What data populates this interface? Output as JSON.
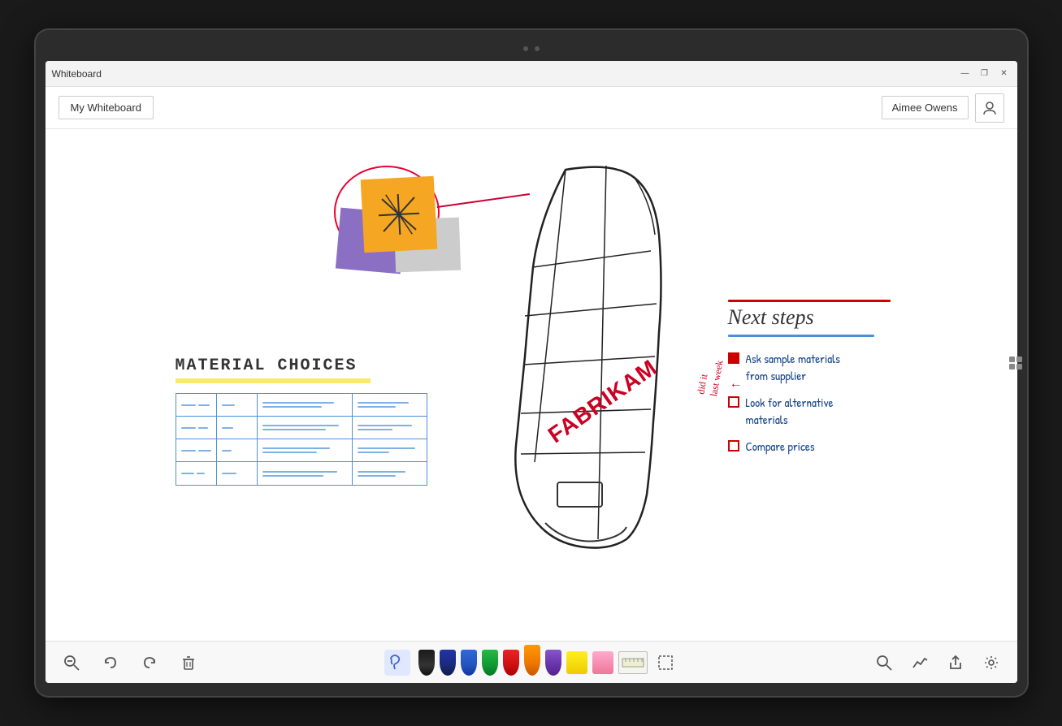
{
  "device": {
    "title_bar": {
      "title": "Whiteboard",
      "minimize": "—",
      "restore": "❐",
      "close": "✕"
    }
  },
  "app_bar": {
    "my_whiteboard_label": "My Whiteboard",
    "user_name": "Aimee Owens",
    "user_icon": "👤"
  },
  "canvas": {
    "material_choices": {
      "title": "Material Choices"
    },
    "next_steps": {
      "title": "Next steps",
      "steps": [
        {
          "text": "Ask sample materials\nfrom supplier",
          "done": true
        },
        {
          "text": "Look for alternative\nmaterials",
          "done": false
        },
        {
          "text": "Compare prices",
          "done": false
        }
      ],
      "annotation": "did it\nlast week"
    },
    "shoe": {
      "brand": "FABRIKAM"
    }
  },
  "toolbar": {
    "zoom_out": "🔍",
    "undo": "↩",
    "redo": "↪",
    "delete": "🗑",
    "lasso": "✋",
    "pens": [
      "black",
      "dark-blue",
      "blue",
      "green",
      "red",
      "orange",
      "purple",
      "yellow-highlight",
      "pink-highlight"
    ],
    "ruler": "ruler",
    "select": "⬚",
    "search": "🔍",
    "analytics": "📈",
    "share": "⬆",
    "settings": "⚙"
  }
}
